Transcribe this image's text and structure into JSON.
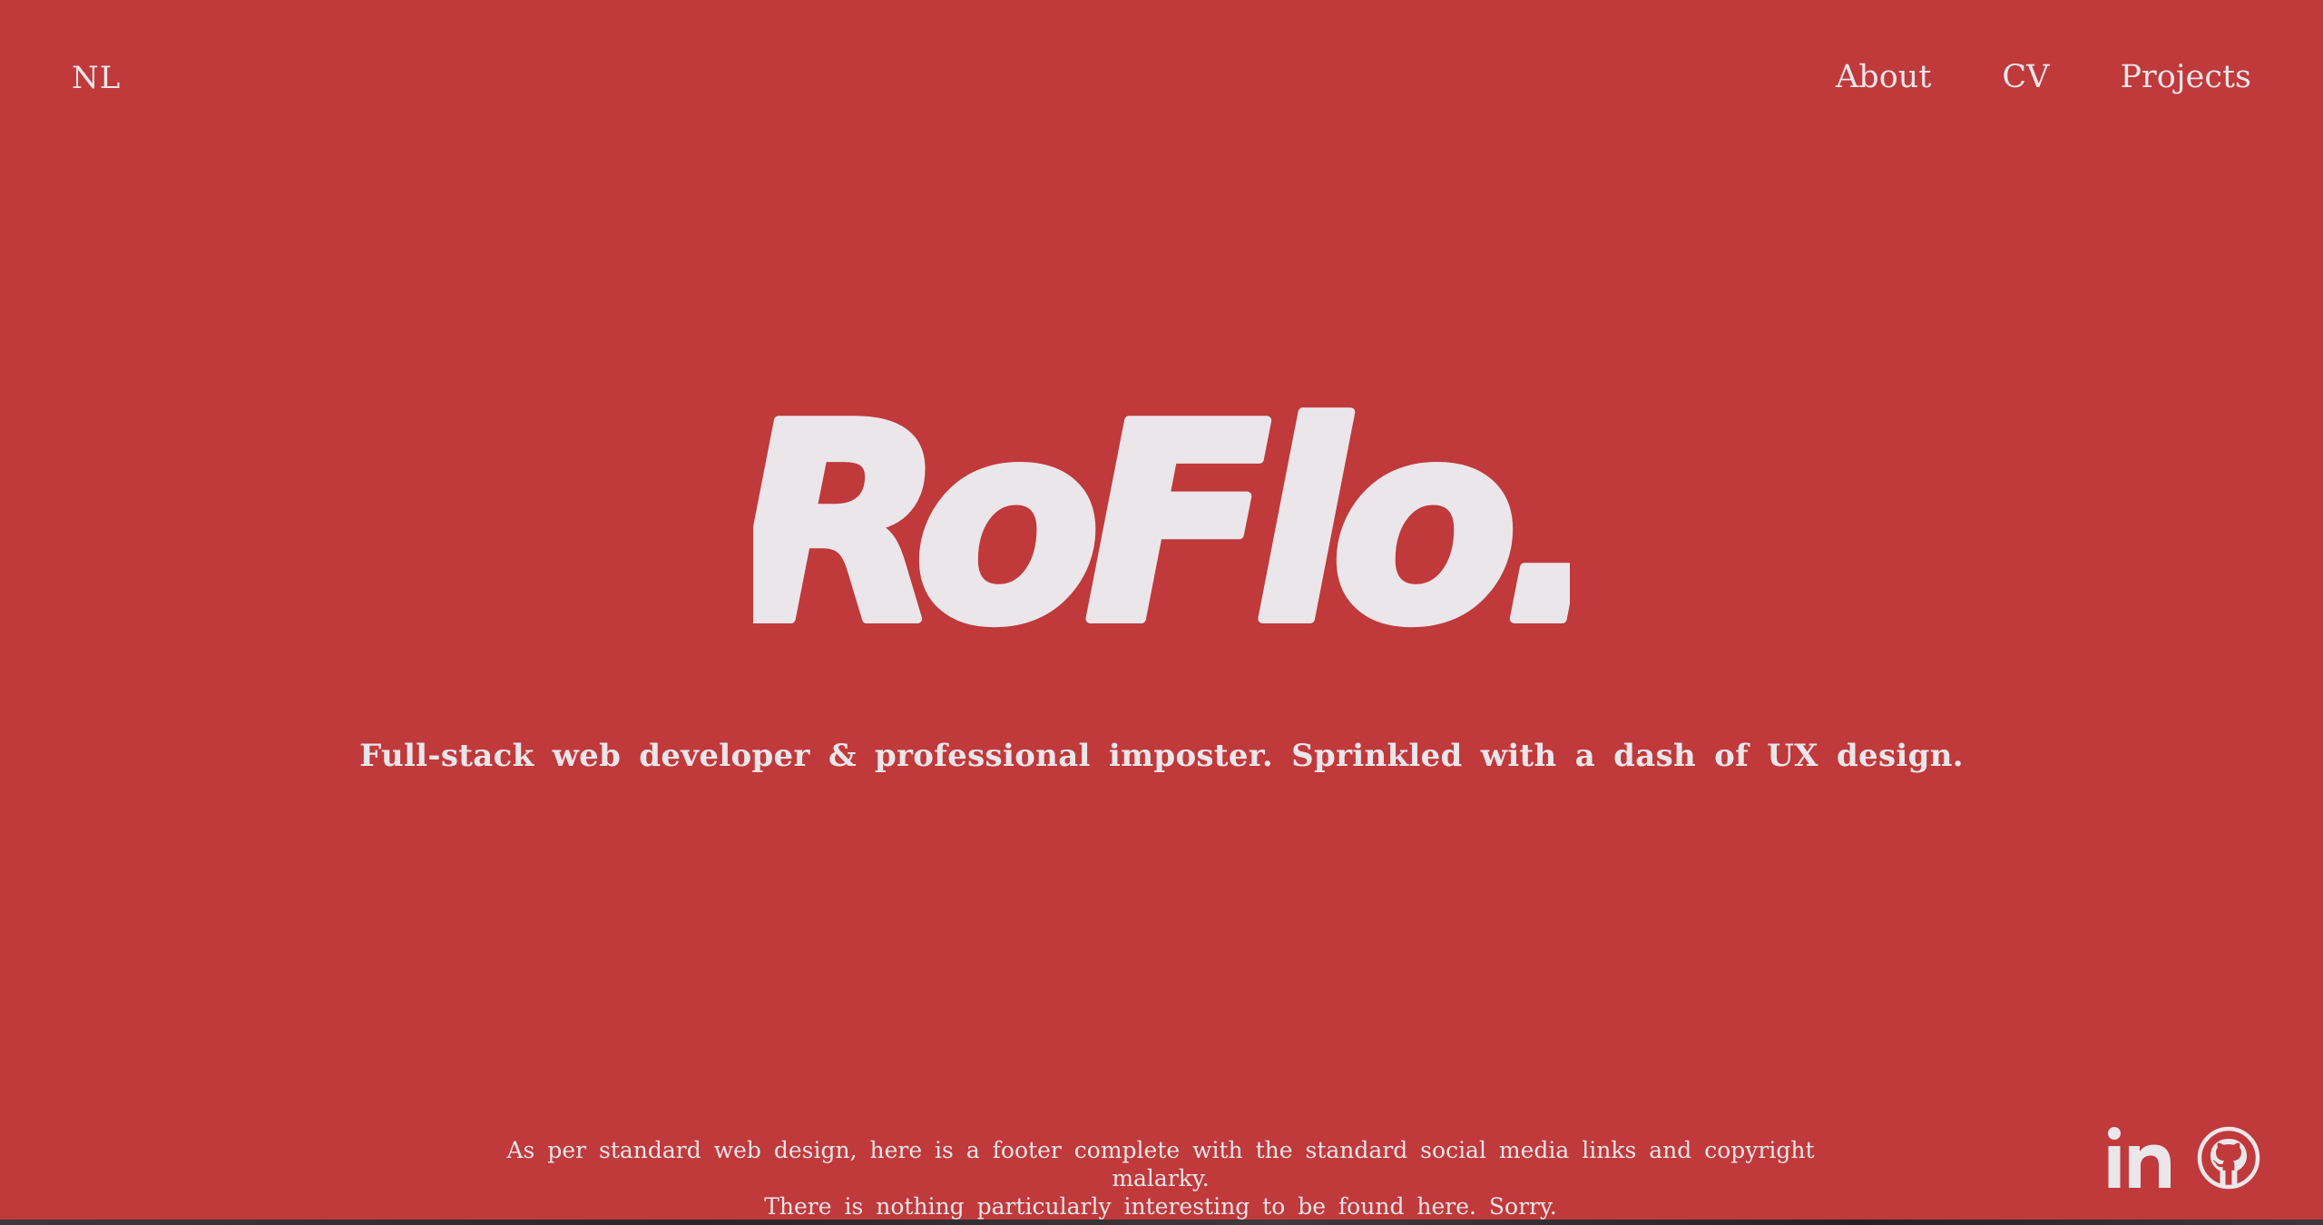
{
  "theme": {
    "background": "#c0393b",
    "foreground": "#ebe6ea"
  },
  "header": {
    "brand": "NL",
    "nav": [
      {
        "label": "About"
      },
      {
        "label": "CV"
      },
      {
        "label": "Projects"
      }
    ]
  },
  "hero": {
    "logo_text": "RoFlo.",
    "tagline": "Full-stack web developer & professional imposter. Sprinkled with a dash of UX design."
  },
  "footer": {
    "line1": "As per standard web design, here is a footer complete with the standard social media links and copyright malarky.",
    "line2": "There is nothing particularly interesting to be found here. Sorry.",
    "social": [
      {
        "icon": "linkedin-icon"
      },
      {
        "icon": "github-icon"
      }
    ]
  }
}
